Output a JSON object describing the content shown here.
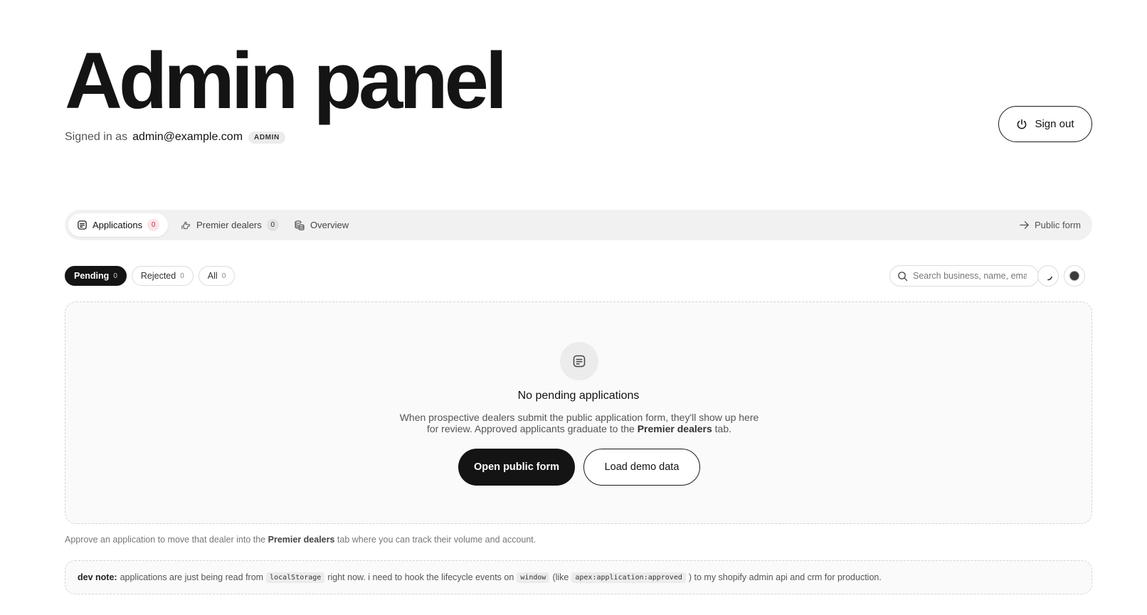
{
  "header": {
    "title": "Admin panel",
    "signed_in_label": "Signed in as",
    "email": "admin@example.com",
    "role": "ADMIN",
    "signout_label": "Sign out"
  },
  "tabs": [
    {
      "label": "Applications",
      "count": "0",
      "icon": "document-icon"
    },
    {
      "label": "Premier dealers",
      "count": "0",
      "icon": "hand-icon"
    },
    {
      "label": "Overview",
      "icon": "coins-icon"
    }
  ],
  "public_form_link": "Public form",
  "filters": [
    {
      "label": "Pending",
      "count": "0"
    },
    {
      "label": "Rejected",
      "count": "0"
    },
    {
      "label": "All",
      "count": "0"
    }
  ],
  "search": {
    "placeholder": "Search business, name, email"
  },
  "empty_state": {
    "title": "No pending applications",
    "desc_part1": "When prospective dealers submit the public application form, they'll show up here for review. Approved applicants graduate to the",
    "desc_bold": "Premier dealers",
    "desc_part2": "tab.",
    "primary_button": "Open public form",
    "secondary_button": "Load demo data"
  },
  "help_text": {
    "part1": "Approve an application to move that dealer into the",
    "bold": "Premier dealers",
    "part2": "tab where you can track their volume and account."
  },
  "dev_note": {
    "label": "dev note:",
    "text1": "applications are just being read from",
    "code1": "localStorage",
    "text2": "right now. i need to hook the lifecycle events on",
    "code2": "window",
    "text3": "(like",
    "code3": "apex:application:approved",
    "text4": ") to my shopify admin api and crm for production."
  },
  "colors": {
    "accent": "#141414",
    "badge_red_bg": "#fde4e8",
    "badge_red_text": "#c2334d",
    "surface": "#f1f1f1"
  }
}
